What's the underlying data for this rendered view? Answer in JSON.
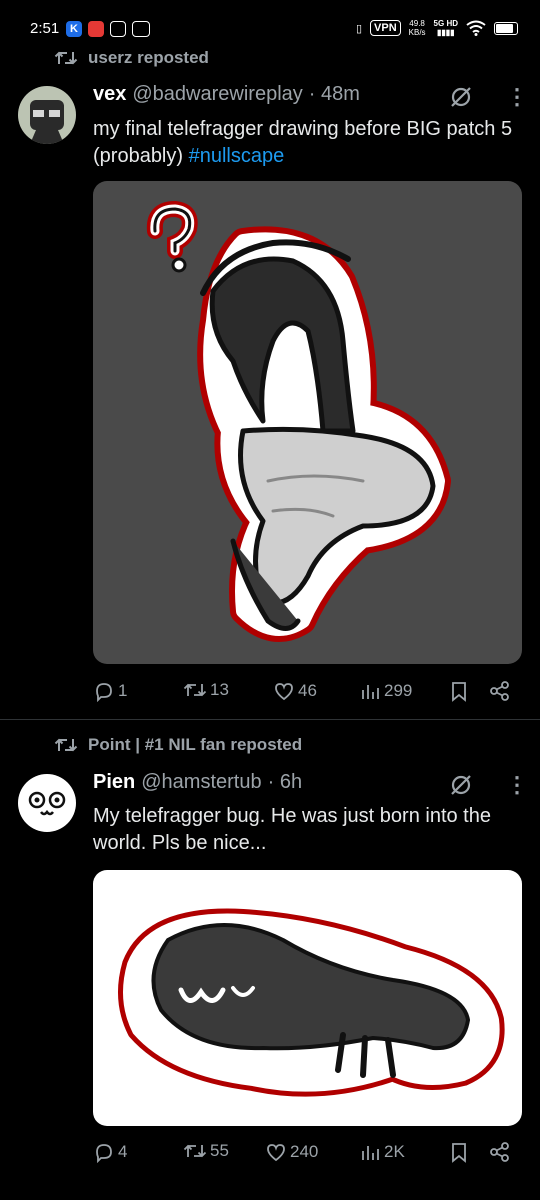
{
  "status_bar": {
    "time": "2:51",
    "vpn": "VPN",
    "speed_value": "49.8",
    "speed_unit": "KB/s",
    "network": "5G HD"
  },
  "posts": [
    {
      "repost_label": "userz reposted",
      "name": "vex",
      "handle": "@badwarewireplay",
      "time": "· 48m",
      "text": "my final telefragger drawing before BIG patch 5 (probably) ",
      "hashtag": "#nullscape",
      "replies": "1",
      "reposts": "13",
      "likes": "46",
      "views": "299"
    },
    {
      "repost_label": "Point | #1 NIL fan reposted",
      "name": "Pien",
      "handle": "@hamstertub",
      "time": "· 6h",
      "text": "My telefragger bug. He was just born into the world. Pls be nice...",
      "replies": "4",
      "reposts": "55",
      "likes": "240",
      "views": "2K"
    }
  ],
  "colors": {
    "background": "#000000",
    "link": "#1d9bf0",
    "muted": "#9ca3a9"
  }
}
